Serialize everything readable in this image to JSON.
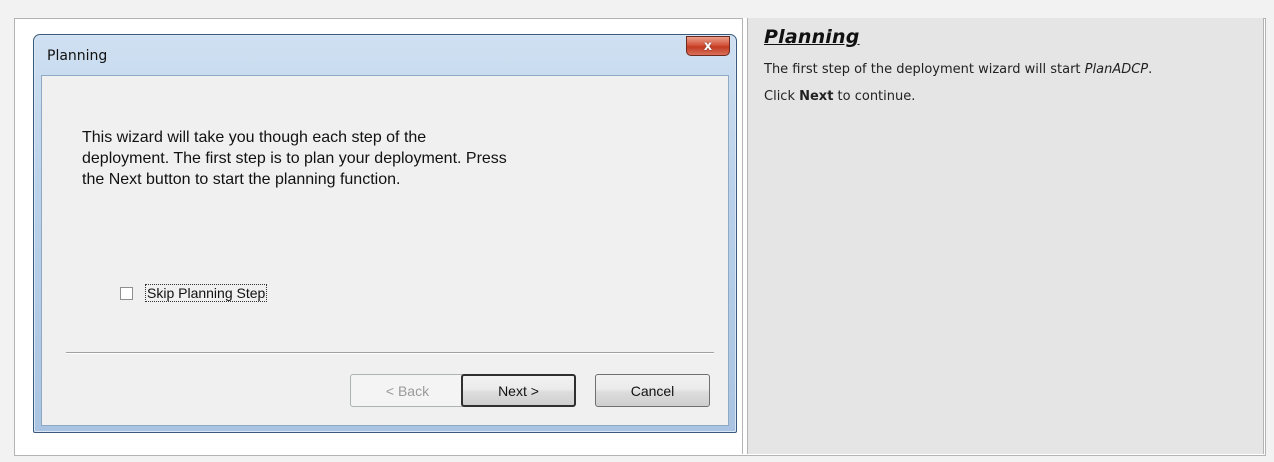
{
  "dialog": {
    "title": "Planning",
    "close_label": "x",
    "message": "This wizard will take you though each step of the deployment.  The first step is to plan your deployment.  Press the Next button to start the planning function.",
    "checkbox_label": "Skip Planning Step",
    "checkbox_checked": false,
    "buttons": {
      "back": "< Back",
      "next": "Next >",
      "cancel": "Cancel"
    }
  },
  "help": {
    "title": "Planning",
    "para1_prefix": "The first step of the deployment wizard will start ",
    "para1_emph": "PlanADCP",
    "para1_suffix": ".",
    "para2_prefix": "Click ",
    "para2_bold": "Next",
    "para2_suffix": " to continue."
  },
  "colors": {
    "close_button": "#c23b22",
    "help_background": "#e5e5e5",
    "window_frame": "#b9d1ea"
  }
}
